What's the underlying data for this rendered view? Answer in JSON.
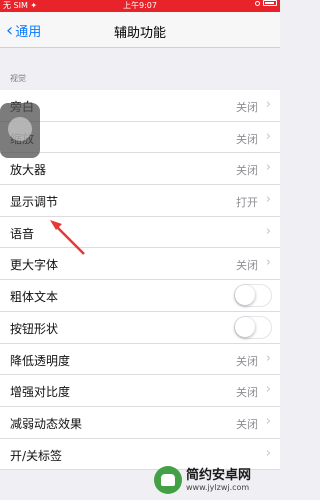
{
  "status_bar": {
    "carrier": "无 SIM ✦",
    "time": "上午9:07"
  },
  "nav": {
    "back_label": "通用",
    "title": "辅助功能"
  },
  "section": {
    "header": "视觉"
  },
  "rows": [
    {
      "label": "旁白",
      "value": "关闭",
      "type": "link"
    },
    {
      "label": "缩放",
      "value": "关闭",
      "type": "link"
    },
    {
      "label": "放大器",
      "value": "关闭",
      "type": "link"
    },
    {
      "label": "显示调节",
      "value": "打开",
      "type": "link"
    },
    {
      "label": "语音",
      "value": "",
      "type": "link"
    },
    {
      "label": "更大字体",
      "value": "关闭",
      "type": "link"
    },
    {
      "label": "粗体文本",
      "type": "toggle",
      "on": false
    },
    {
      "label": "按钮形状",
      "type": "toggle",
      "on": false
    },
    {
      "label": "降低透明度",
      "value": "关闭",
      "type": "link"
    },
    {
      "label": "增强对比度",
      "value": "关闭",
      "type": "link"
    },
    {
      "label": "减弱动态效果",
      "value": "关闭",
      "type": "link"
    },
    {
      "label": "开/关标签",
      "value": "",
      "type": "link"
    }
  ],
  "watermark": {
    "name": "简约安卓网",
    "url": "www.jylzwj.com"
  },
  "colors": {
    "status_bar": "#e8242a",
    "link_blue": "#0a7aff",
    "annotation_arrow": "#e53935"
  }
}
